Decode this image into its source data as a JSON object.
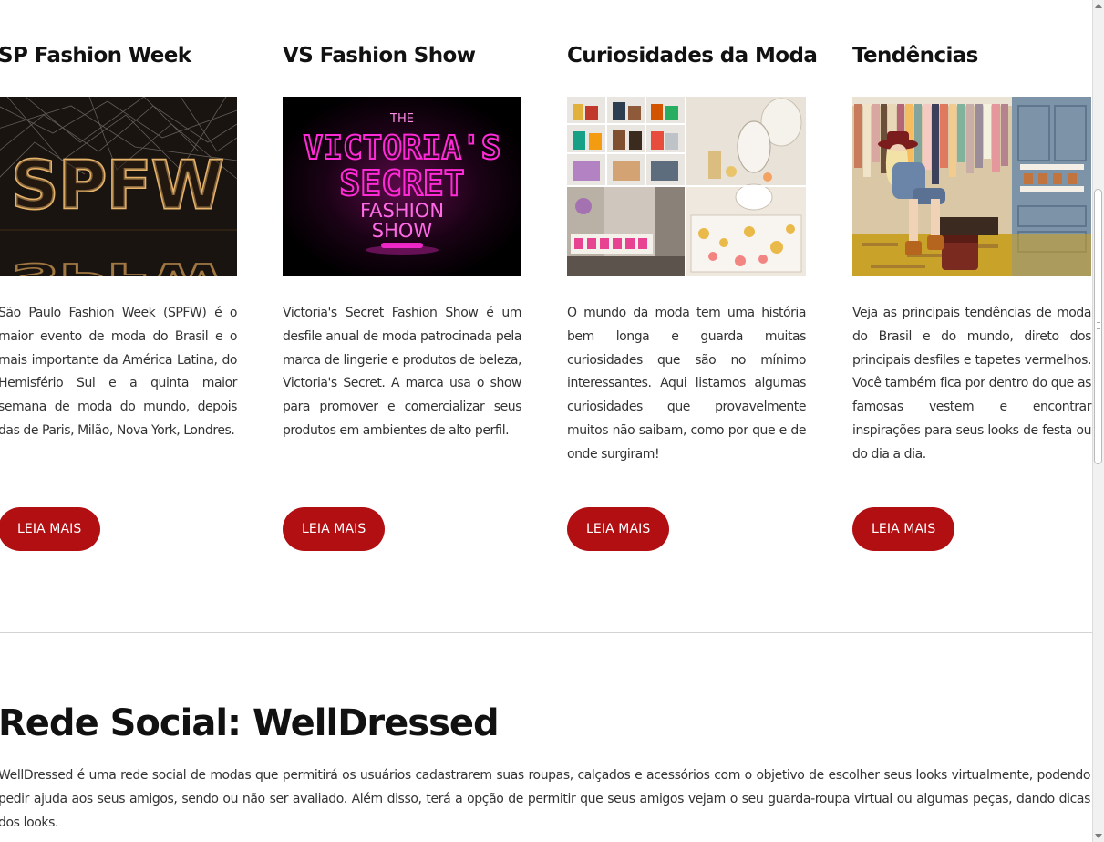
{
  "cards": [
    {
      "title": "SP Fashion Week",
      "image_label": "SPFW",
      "text": "São Paulo Fashion Week (SPFW) é o maior evento de moda do Brasil e o mais importante da América Latina, do Hemisfério Sul e a quinta maior semana de moda do mundo, depois das de Paris, Milão, Nova York, Londres.",
      "button": "LEIA MAIS"
    },
    {
      "title": "VS Fashion Show",
      "image_label": "THE VICTORIA'S SECRET FASHION SHOW",
      "text": "Victoria's Secret Fashion Show é um desfile anual de moda patrocinada pela marca de lingerie e produtos de beleza, Victoria's Secret. A marca usa o show para promover e comercializar seus produtos em ambientes de alto perfil.",
      "button": "LEIA MAIS"
    },
    {
      "title": "Curiosidades da Moda",
      "text": "O mundo da moda tem uma história bem longa e guarda muitas curiosidades que são no mínimo interessantes. Aqui listamos algumas curiosidades que provavelmente muitos não saibam, como por que e de onde surgiram!",
      "button": "LEIA MAIS"
    },
    {
      "title": "Tendências",
      "text": "Veja as principais tendências de moda do Brasil e do mundo, direto dos principais desfiles e tapetes vermelhos. Você também fica por dentro do que as famosas vestem e encontrar inspirações para seus looks de festa ou do dia a dia.",
      "button": "LEIA MAIS"
    }
  ],
  "social": {
    "title": "Rede Social: WellDressed",
    "text": "WellDressed é uma rede social de modas que permitirá os usuários cadastrarem suas roupas, calçados e acessórios com o objetivo de escolher seus looks virtualmente, podendo pedir ajuda aos seus amigos, sendo ou não ser avaliado. Além disso, terá a opção de permitir que seus amigos vejam o seu guarda-roupa virtual ou algumas peças, dando dicas dos looks."
  },
  "colors": {
    "button": "#b20f12",
    "divider": "#d4d4d4",
    "vs_neon": "#ff2bd6"
  }
}
